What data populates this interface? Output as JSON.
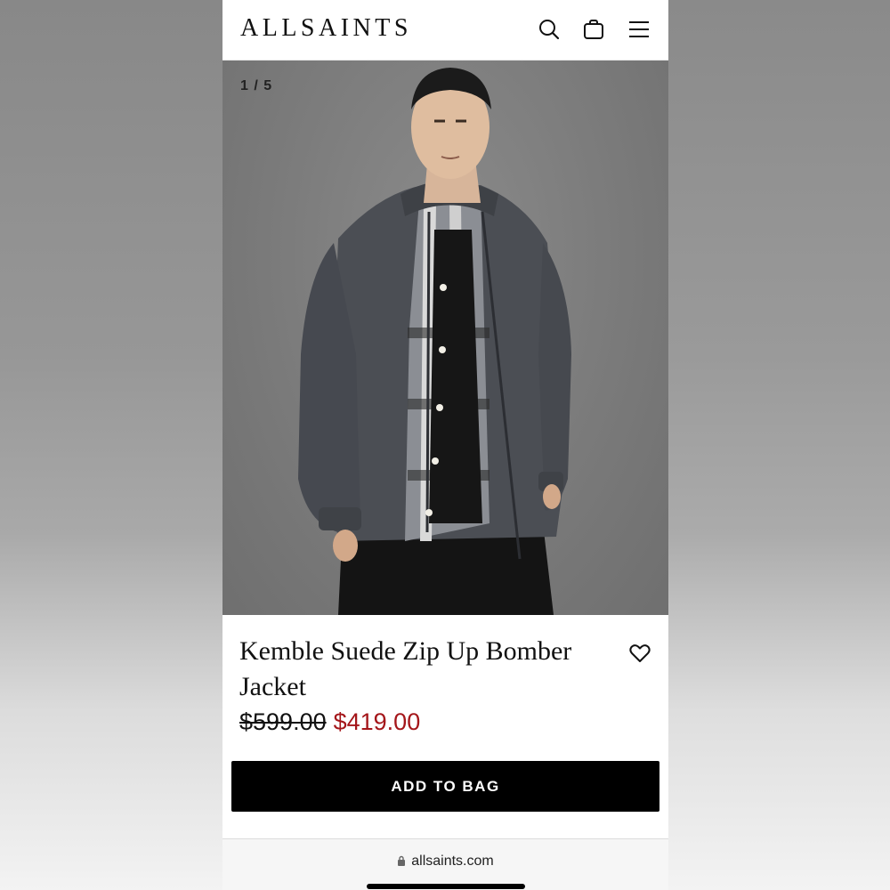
{
  "brand": {
    "logo": "ALLSAINTS"
  },
  "header": {
    "icons": [
      "search-icon",
      "bag-icon",
      "menu-icon"
    ]
  },
  "gallery": {
    "counter": "1 / 5"
  },
  "product": {
    "title": "Kemble Suede Zip Up Bomber Jacket",
    "price_original": "$599.00",
    "price_sale": "$419.00",
    "add_to_bag": "ADD TO BAG"
  },
  "browser": {
    "url": "allsaints.com"
  },
  "colors": {
    "sale_price": "#a4161a",
    "button": "#000000"
  }
}
